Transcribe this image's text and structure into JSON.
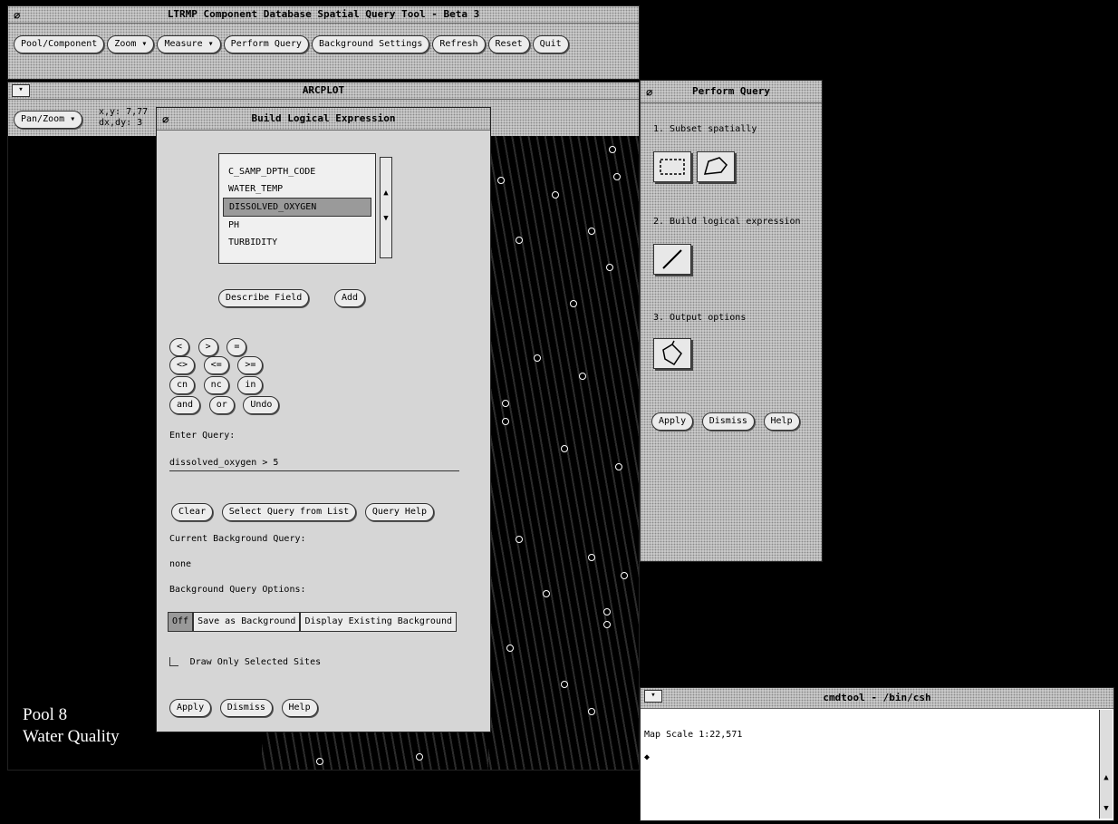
{
  "main_window": {
    "title": "LTRMP Component Database Spatial Query Tool - Beta 3",
    "buttons": [
      "Pool/Component",
      "Zoom",
      "Measure",
      "Perform Query",
      "Background Settings",
      "Refresh",
      "Reset",
      "Quit"
    ]
  },
  "arcplot": {
    "title": "ARCPLOT",
    "panzoom_label": "Pan/Zoom",
    "coords_line1": "x,y: 7,77",
    "coords_line2": "dx,dy: 3",
    "map_caption_line1": "Pool 8",
    "map_caption_line2": "Water Quality"
  },
  "build_expression": {
    "title": "Build Logical Expression",
    "fields": [
      "C_SAMP_DPTH_CODE",
      "WATER_TEMP",
      "DISSOLVED_OXYGEN",
      "PH",
      "TURBIDITY"
    ],
    "selected_field": "DISSOLVED_OXYGEN",
    "describe_label": "Describe Field",
    "add_label": "Add",
    "operators_row1": [
      "<",
      ">",
      "="
    ],
    "operators_row2": [
      "<>",
      "<=",
      ">="
    ],
    "operators_row3": [
      "cn",
      "nc",
      "in"
    ],
    "operators_row4": [
      "and",
      "or",
      "Undo"
    ],
    "enter_query_label": "Enter Query:",
    "query_value": "dissolved_oxygen > 5",
    "clear_label": "Clear",
    "select_query_label": "Select Query from List",
    "query_help_label": "Query Help",
    "current_bg_label": "Current Background Query:",
    "current_bg_value": "none",
    "bg_options_label": "Background Query Options:",
    "bg_options": [
      "Off",
      "Save as Background",
      "Display Existing Background"
    ],
    "bg_selected": "Off",
    "draw_only_label": "Draw Only Selected Sites",
    "apply_label": "Apply",
    "dismiss_label": "Dismiss",
    "help_label": "Help"
  },
  "perform_query": {
    "title": "Perform Query",
    "step1": "1. Subset spatially",
    "step2": "2. Build logical expression",
    "step3": "3. Output options",
    "apply_label": "Apply",
    "dismiss_label": "Dismiss",
    "help_label": "Help"
  },
  "cmdtool": {
    "title": "cmdtool - /bin/csh",
    "output": "Map Scale 1:22,571",
    "prompt": "◆"
  },
  "icons": {
    "rect_select": "rectangle-select-icon",
    "polygon_select": "polygon-select-icon",
    "pencil": "pencil-icon",
    "paint_bucket": "paint-bucket-icon"
  }
}
